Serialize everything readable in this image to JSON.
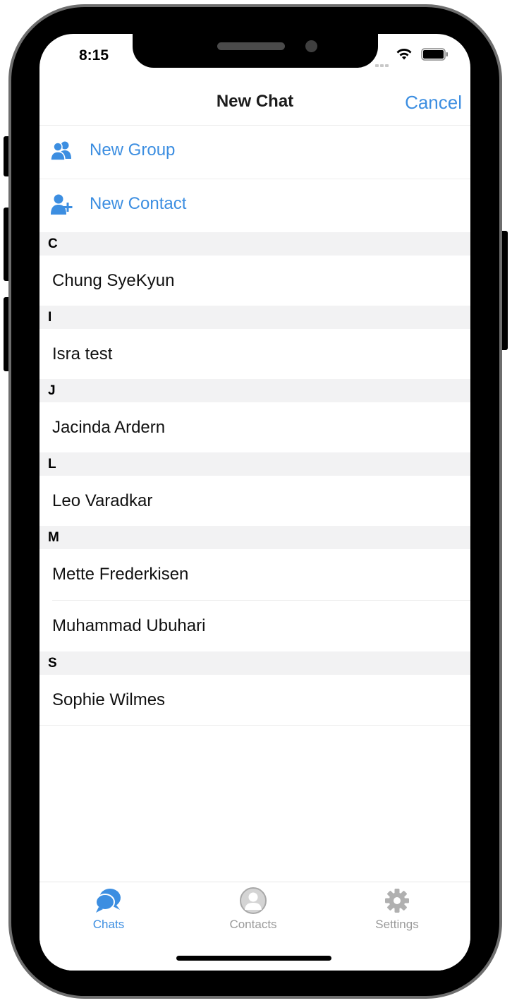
{
  "status_bar": {
    "time": "8:15"
  },
  "nav": {
    "title": "New Chat",
    "cancel_label": "Cancel"
  },
  "actions": [
    {
      "label": "New Group",
      "icon": "group-icon"
    },
    {
      "label": "New Contact",
      "icon": "add-contact-icon"
    }
  ],
  "sections": [
    {
      "letter": "C",
      "contacts": [
        "Chung SyeKyun"
      ]
    },
    {
      "letter": "I",
      "contacts": [
        "Isra test"
      ]
    },
    {
      "letter": "J",
      "contacts": [
        "Jacinda Ardern"
      ]
    },
    {
      "letter": "L",
      "contacts": [
        "Leo Varadkar"
      ]
    },
    {
      "letter": "M",
      "contacts": [
        "Mette Frederkisen",
        "Muhammad Ubuhari"
      ]
    },
    {
      "letter": "S",
      "contacts": [
        "Sophie Wilmes"
      ]
    }
  ],
  "tabs": [
    {
      "label": "Chats",
      "icon": "chat-bubbles-icon",
      "active": true
    },
    {
      "label": "Contacts",
      "icon": "person-circle-icon",
      "active": false
    },
    {
      "label": "Settings",
      "icon": "gear-icon",
      "active": false
    }
  ],
  "colors": {
    "accent": "#3c8ee1",
    "inactive": "#9a9a9a",
    "section_bg": "#f2f2f3"
  }
}
